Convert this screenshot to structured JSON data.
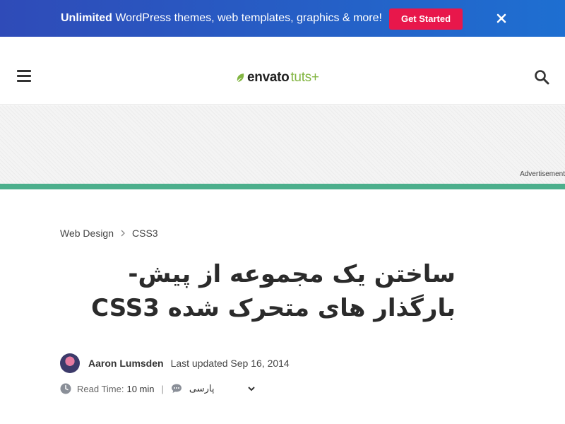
{
  "promo": {
    "bold_text": "Unlimited",
    "text": " WordPress themes, web templates, graphics & more!",
    "button_label": "Get Started",
    "accent_color": "#e8174b"
  },
  "header": {
    "logo_envato": "envato",
    "logo_tuts": "tuts+",
    "logo_color": "#82b541"
  },
  "ad": {
    "label": "Advertisement"
  },
  "article": {
    "breadcrumb": [
      "Web Design",
      "CSS3"
    ],
    "title": "ساختن یک مجموعه از پیش-بارگذار های متحرک شده CSS3",
    "author_name": "Aaron Lumsden",
    "updated": "Last updated Sep 16, 2014",
    "read_time_label": "Read Time:",
    "read_time_value": "10 min",
    "divider": "|",
    "language": "پارسی"
  },
  "icons": [
    "close-icon",
    "menu-icon",
    "leaf-icon",
    "search-icon",
    "chevron-right-icon",
    "clock-icon",
    "chat-icon",
    "chevron-down-icon"
  ]
}
